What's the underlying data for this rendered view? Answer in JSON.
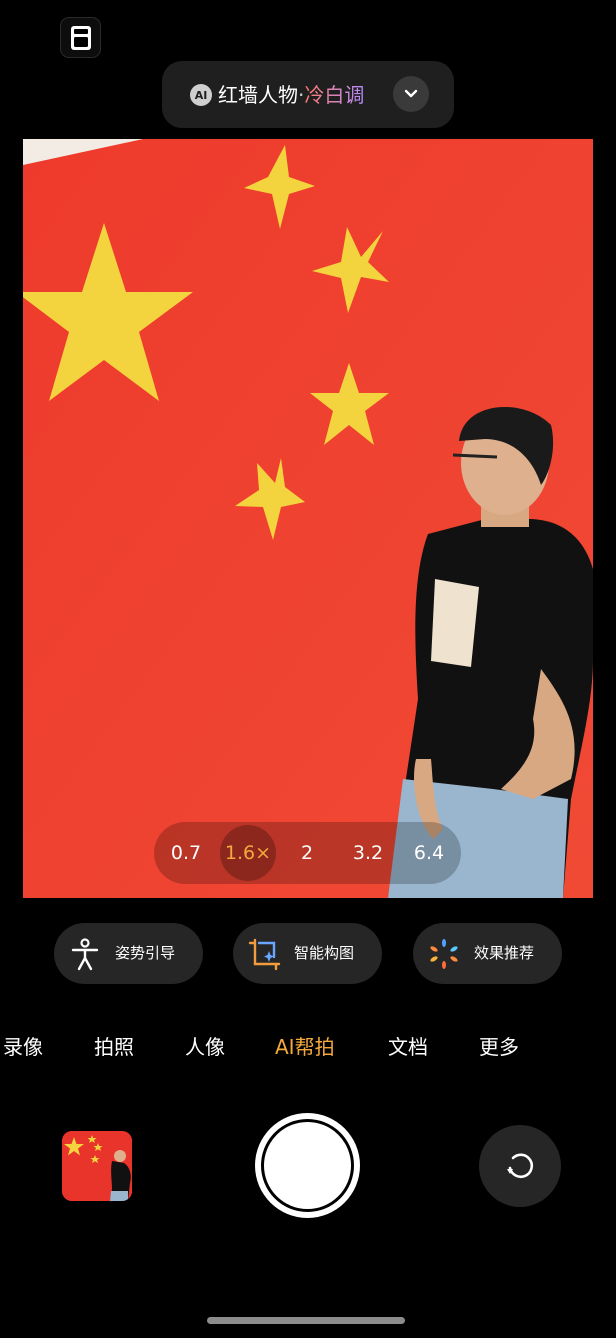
{
  "top": {
    "icon": "layout-panel-icon"
  },
  "scene": {
    "badge": "AI",
    "name": "红墙人物",
    "separator": "·",
    "tone": "冷白调",
    "expand_icon": "chevron-down-icon"
  },
  "zoom": {
    "options": [
      "0.7",
      "1.6×",
      "2",
      "3.2",
      "6.4"
    ],
    "selected": "1.6×",
    "selected_color": "#f3a93c"
  },
  "tools": [
    {
      "label": "姿势引导",
      "icon": "pose-figure-icon"
    },
    {
      "label": "智能构图",
      "icon": "crop-sparkle-icon"
    },
    {
      "label": "效果推荐",
      "icon": "color-burst-icon"
    }
  ],
  "modes": [
    "录像",
    "拍照",
    "人像",
    "AI帮拍",
    "文档",
    "更多"
  ],
  "active_mode": "AI帮拍",
  "controls": {
    "gallery_icon": "gallery-thumbnail",
    "shutter_icon": "shutter-button",
    "flip_icon": "rotate-camera-icon"
  },
  "colors": {
    "accent": "#f3a93c",
    "flag_red": "#e8342a",
    "star_yellow": "#f4d43e"
  }
}
